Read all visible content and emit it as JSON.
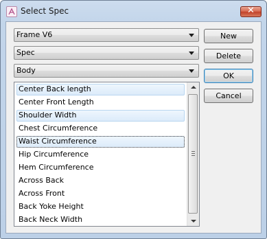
{
  "window": {
    "title": "Select Spec",
    "close_label": "✕"
  },
  "combos": [
    {
      "value": "Frame V6"
    },
    {
      "value": "Spec"
    },
    {
      "value": "Body"
    }
  ],
  "buttons": {
    "new": "New",
    "delete": "Delete",
    "ok": "OK",
    "cancel": "Cancel"
  },
  "list": {
    "items": [
      {
        "label": "Center Back length",
        "state": "selected"
      },
      {
        "label": "Center Front Length",
        "state": "normal"
      },
      {
        "label": "Shoulder Width",
        "state": "selected"
      },
      {
        "label": "Chest Circumference",
        "state": "normal"
      },
      {
        "label": "Waist Circumference",
        "state": "focused"
      },
      {
        "label": "Hip Circumference",
        "state": "normal"
      },
      {
        "label": "Hem Circumference",
        "state": "normal"
      },
      {
        "label": "Across Back",
        "state": "normal"
      },
      {
        "label": "Across Front",
        "state": "normal"
      },
      {
        "label": "Back Yoke Height",
        "state": "normal"
      },
      {
        "label": "Back Neck Width",
        "state": "normal"
      }
    ]
  }
}
